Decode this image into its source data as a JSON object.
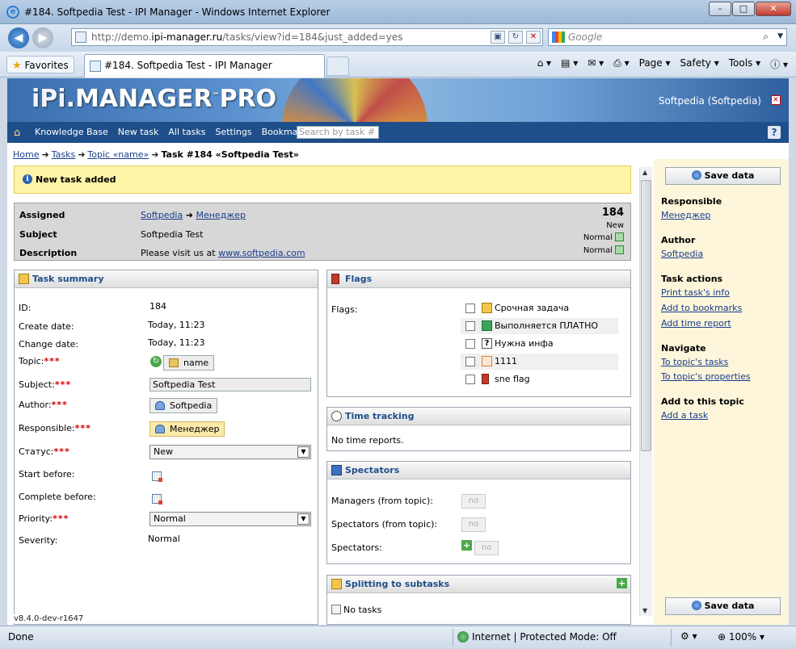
{
  "window": {
    "title": "#184. Softpedia Test - IPI Manager - Windows Internet Explorer",
    "min": "–",
    "max": "□",
    "close": "✕"
  },
  "address": {
    "url_prefix": "http://demo.",
    "url_domain": "ipi-manager.ru",
    "url_path": "/tasks/view?id=184&just_added=yes",
    "search_placeholder": "Google"
  },
  "command_bar": {
    "favorites": "Favorites",
    "tab_title": "#184. Softpedia Test - IPI Manager",
    "page": "Page ▾",
    "safety": "Safety ▾",
    "tools": "Tools ▾"
  },
  "banner": {
    "logo_ipi": "iPi",
    "logo_manager": ".MANAGER",
    "logo_tm": "™",
    "logo_pro": "PRO",
    "user": "Softpedia (Softpedia)"
  },
  "menu": {
    "items": [
      "Knowledge Base",
      "New task",
      "All tasks",
      "Settings",
      "Bookmarks"
    ],
    "search_placeholder": "Search by task #",
    "help": "?"
  },
  "breadcrumb": {
    "home": "Home",
    "tasks": "Tasks",
    "topic": "Topic «name»",
    "current": "Task #184 «Softpedia Test»"
  },
  "notice": "New task added",
  "summary_box": {
    "assigned_label": "Assigned",
    "assigned_from": "Softpedia",
    "assigned_to": "Менеджер",
    "subject_label": "Subject",
    "subject": "Softpedia Test",
    "description_label": "Description",
    "description_text": "Please visit us at ",
    "description_link": "www.softpedia.com",
    "task_number": "184",
    "status": "New",
    "priority": "Normal",
    "severity": "Normal"
  },
  "task_summary": {
    "title": "Task summary",
    "id_label": "ID:",
    "id": "184",
    "create_label": "Create date:",
    "create": "Today, 11:23",
    "change_label": "Change date:",
    "change": "Today, 11:23",
    "topic_label": "Topic:",
    "topic": "name",
    "subject_label": "Subject:",
    "subject": "Softpedia Test",
    "author_label": "Author:",
    "author": "Softpedia",
    "responsible_label": "Responsible:",
    "responsible": "Менеджер",
    "status_label": "Статус:",
    "status": "New",
    "start_label": "Start before:",
    "complete_label": "Complete before:",
    "priority_label": "Priority:",
    "priority": "Normal",
    "severity_label": "Severity:",
    "severity": "Normal",
    "required_mark": "***"
  },
  "flags": {
    "title": "Flags",
    "label": "Flags:",
    "items": [
      "Срочная задача",
      "Выполняется ПЛАТНО",
      "Нужна инфа",
      "1111",
      "sne flag"
    ]
  },
  "time_tracking": {
    "title": "Time tracking",
    "empty": "No time reports."
  },
  "spectators": {
    "title": "Spectators",
    "managers_label": "Managers (from topic):",
    "spectators_topic_label": "Spectators (from topic):",
    "spectators_label": "Spectators:",
    "no": "no"
  },
  "subtasks": {
    "title": "Splitting to subtasks",
    "empty": "No tasks"
  },
  "sidebar": {
    "save": "Save data",
    "responsible_h": "Responsible",
    "responsible": "Менеджер",
    "author_h": "Author",
    "author": "Softpedia",
    "actions_h": "Task actions",
    "actions": [
      "Print task's info",
      "Add to bookmarks",
      "Add time report"
    ],
    "navigate_h": "Navigate",
    "navigate": [
      "To topic's tasks",
      "To topic's properties"
    ],
    "add_h": "Add to this topic",
    "add": "Add a task"
  },
  "version": "v8.4.0-dev-r1647",
  "status_bar": {
    "done": "Done",
    "zone": "Internet | Protected Mode: Off",
    "zoom": "100%"
  }
}
